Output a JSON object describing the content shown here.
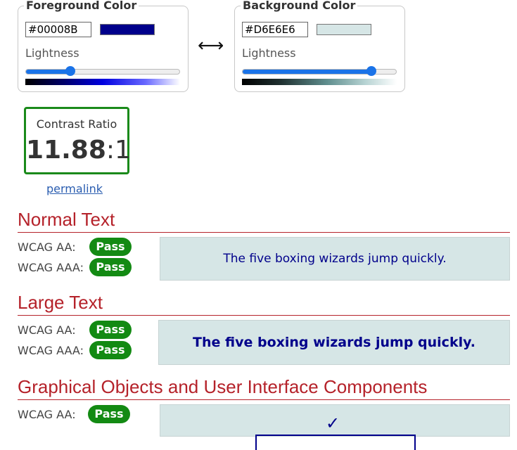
{
  "foreground": {
    "title": "Foreground Color",
    "hex": "#00008B",
    "lightness_label": "Lightness",
    "lightness_fraction": 0.29,
    "swatch_color": "#00008B"
  },
  "background": {
    "title": "Background Color",
    "hex": "#D6E6E6",
    "lightness_label": "Lightness",
    "lightness_fraction": 0.84,
    "swatch_color": "#D6E6E6"
  },
  "swap_symbol": "⟷",
  "contrast": {
    "label": "Contrast Ratio",
    "value_bold": "11.88",
    "value_rest": ":1"
  },
  "permalink_label": "permalink",
  "sections": {
    "normal": {
      "title": "Normal Text",
      "aa_label": "WCAG AA:",
      "aa_result": "Pass",
      "aaa_label": "WCAG AAA:",
      "aaa_result": "Pass",
      "sample": "The five boxing wizards jump quickly."
    },
    "large": {
      "title": "Large Text",
      "aa_label": "WCAG AA:",
      "aa_result": "Pass",
      "aaa_label": "WCAG AAA:",
      "aaa_result": "Pass",
      "sample": "The five boxing wizards jump quickly."
    },
    "graphical": {
      "title": "Graphical Objects and User Interface Components",
      "aa_label": "WCAG AA:",
      "aa_result": "Pass",
      "check_symbol": "✓"
    }
  },
  "colors": {
    "pass_green": "#138a13",
    "section_red": "#b5222a",
    "slider_blue": "#1a73e8",
    "contrast_border": "#1a8a1a"
  }
}
